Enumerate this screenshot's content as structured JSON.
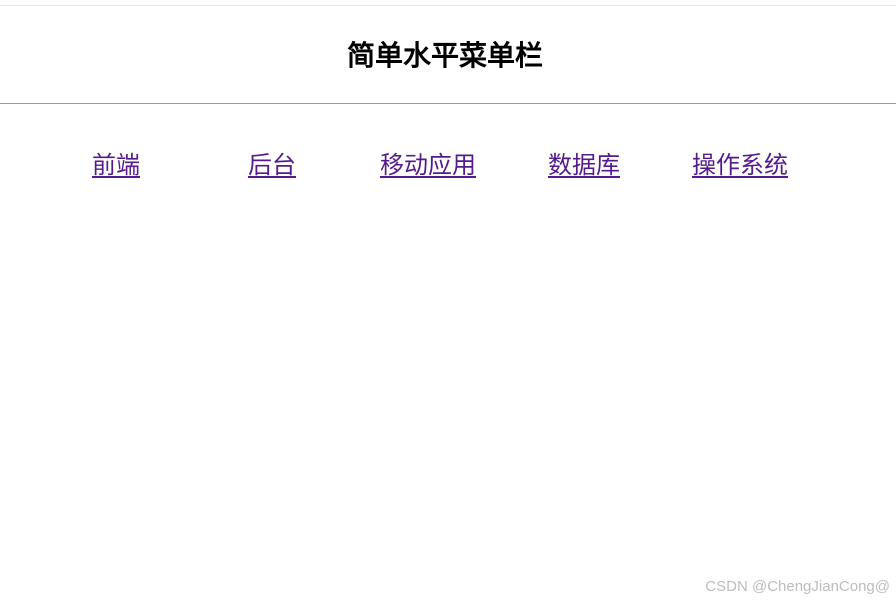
{
  "page": {
    "title": "简单水平菜单栏"
  },
  "nav": {
    "items": [
      {
        "label": "前端"
      },
      {
        "label": "后台"
      },
      {
        "label": "移动应用"
      },
      {
        "label": "数据库"
      },
      {
        "label": "操作系统"
      }
    ],
    "link_color": "#551a8b"
  },
  "watermark": {
    "text": "CSDN @ChengJianCong@"
  }
}
